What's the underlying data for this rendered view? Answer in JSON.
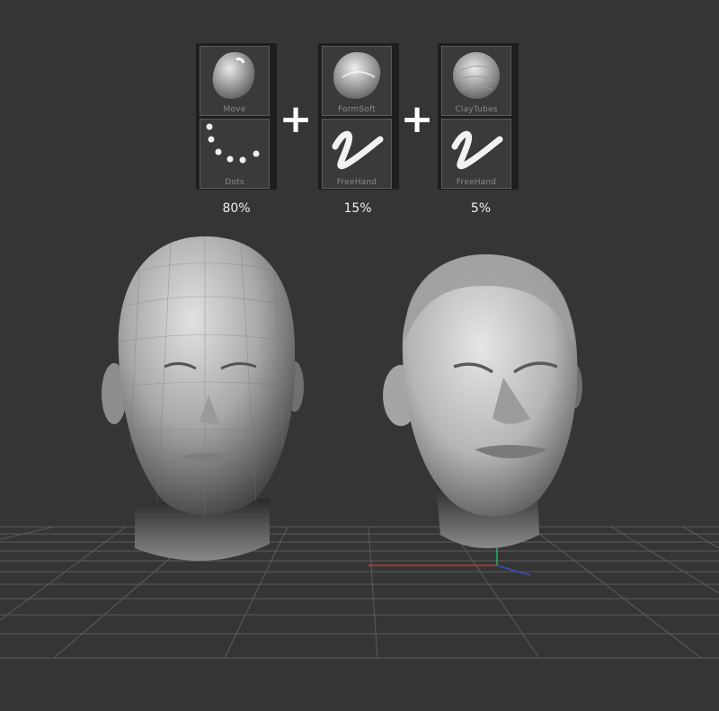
{
  "brush_mix": [
    {
      "top_brush": {
        "label": "Move",
        "icon": "move-brush-icon"
      },
      "stroke": {
        "label": "Dots",
        "icon": "dots-stroke-icon"
      },
      "percent": "80%"
    },
    {
      "top_brush": {
        "label": "FormSoft",
        "icon": "formsoft-brush-icon"
      },
      "stroke": {
        "label": "FreeHand",
        "icon": "freehand-stroke-icon"
      },
      "percent": "15%"
    },
    {
      "top_brush": {
        "label": "ClayTubes",
        "icon": "claytubes-brush-icon"
      },
      "stroke": {
        "label": "FreeHand",
        "icon": "freehand-stroke-icon"
      },
      "percent": "5%"
    }
  ],
  "operators": [
    "+",
    "+"
  ],
  "models": [
    {
      "name": "base-head-model",
      "icon": "low-poly-head-icon"
    },
    {
      "name": "sculpted-head-model",
      "icon": "sculpted-head-icon"
    }
  ],
  "colors": {
    "background": "#353535",
    "grid_line": "#5c5c5c",
    "x_axis": "#c0392b",
    "y_axis": "#27ae60",
    "z_axis": "#3b4cc0"
  }
}
